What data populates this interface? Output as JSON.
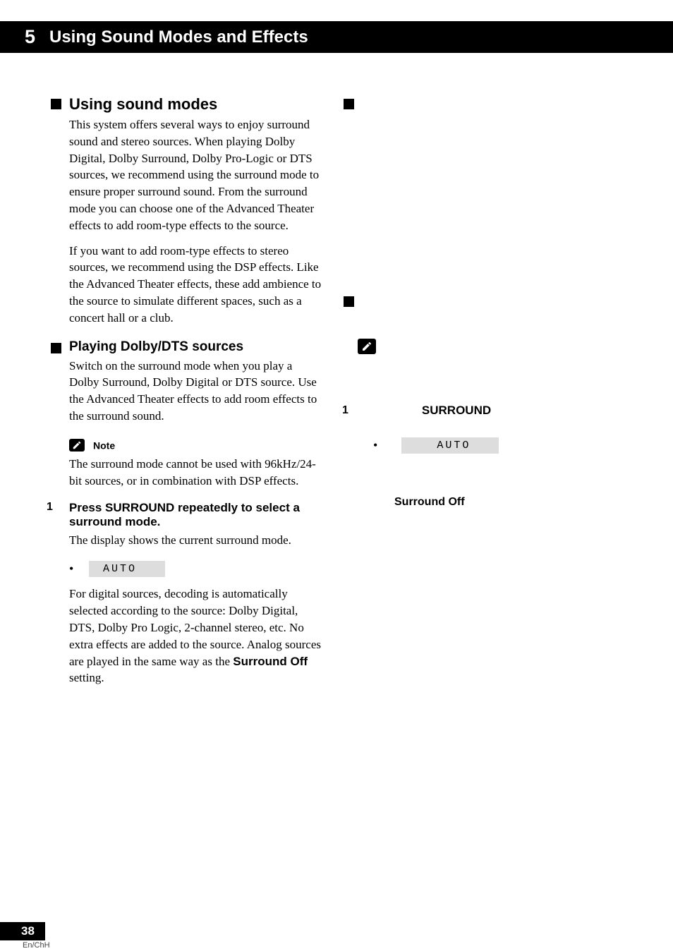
{
  "header": {
    "chapter_num": "5",
    "chapter_title": "Using Sound Modes and Effects"
  },
  "left": {
    "section1": {
      "heading": "Using sound modes",
      "para1": "This system offers several ways to enjoy surround sound and stereo sources. When playing Dolby Digital, Dolby Surround, Dolby Pro-Logic or DTS sources, we recommend using the surround mode to ensure proper surround sound. From the surround mode you can choose one of the Advanced Theater effects to add room-type effects to the source.",
      "para2": "If you want to add room-type effects to stereo sources, we recommend using the DSP effects. Like the Advanced Theater effects, these add ambience to the source to simulate different spaces, such as a concert hall or a club."
    },
    "section2": {
      "heading": "Playing Dolby/DTS sources",
      "para1": "Switch on the surround mode when you play a Dolby Surround, Dolby Digital or DTS source. Use the Advanced Theater effects to add room effects to the surround sound.",
      "note_label": "Note",
      "note_text": "The surround mode cannot be used with 96kHz/24-bit sources, or in combination with DSP effects.",
      "step1_num": "1",
      "step1_heading": "Press SURROUND repeatedly to select a surround mode.",
      "step1_para": "The display shows the current surround mode.",
      "display_auto": "AUTO",
      "after_display_a": "For digital sources, decoding is automatically selected according to the source: Dolby Digital, DTS, Dolby Pro Logic, 2-channel stereo, etc. No extra effects are added to the source. Analog sources are played in the same way as the ",
      "surround_off_bold": "Surround Off",
      "after_display_b": " setting."
    }
  },
  "right": {
    "step1_num": "1",
    "surround_label": "SURROUND",
    "display_auto": "AUTO",
    "surround_off": "Surround Off"
  },
  "footer": {
    "page_num": "38",
    "lang": "En/ChH"
  }
}
